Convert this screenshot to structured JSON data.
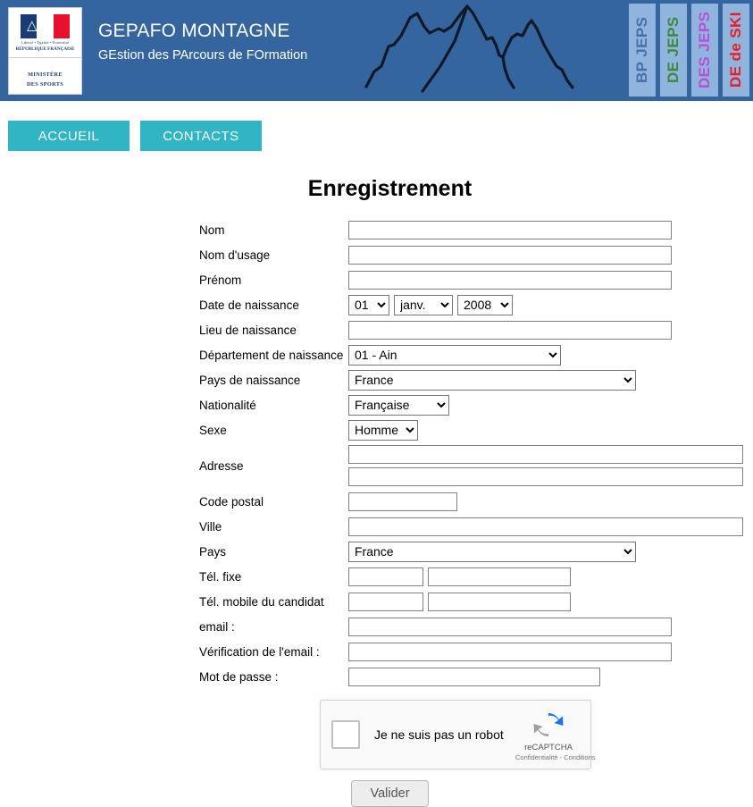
{
  "header": {
    "logo": {
      "devise": "Liberté • Égalité • Fraternité",
      "republic": "RÉPUBLIQUE FRANÇAISE",
      "ministry_line1": "MINISTÈRE",
      "ministry_line2": "DES SPORTS"
    },
    "title": "GEPAFO MONTAGNE",
    "subtitle": "GEstion des PArcours de FOrmation",
    "background_color": "#35659f",
    "badges": [
      {
        "label": "BP JEPS",
        "color": "#4a6fa8"
      },
      {
        "label": "DE JEPS",
        "color": "#3c8a3c"
      },
      {
        "label": "DES JEPS",
        "color": "#b84fd6"
      },
      {
        "label": "DE de SKI",
        "color": "#ee1b24"
      }
    ]
  },
  "nav": {
    "accent_color": "#30b5c4",
    "items": [
      {
        "label": "ACCUEIL"
      },
      {
        "label": "CONTACTS"
      }
    ]
  },
  "main": {
    "title": "Enregistrement",
    "fields": {
      "nom": {
        "label": "Nom",
        "value": ""
      },
      "nom_usage": {
        "label": "Nom d'usage",
        "value": ""
      },
      "prenom": {
        "label": "Prénom",
        "value": ""
      },
      "date_naissance": {
        "label": "Date de naissance",
        "day": "01",
        "month": "janv.",
        "year": "2008"
      },
      "lieu_naissance": {
        "label": "Lieu de naissance",
        "value": ""
      },
      "departement_naissance": {
        "label": "Département de naissance",
        "value": "01 - Ain"
      },
      "pays_naissance": {
        "label": "Pays de naissance",
        "value": "France"
      },
      "nationalite": {
        "label": "Nationalité",
        "value": "Française"
      },
      "sexe": {
        "label": "Sexe",
        "value": "Homme"
      },
      "adresse": {
        "label": "Adresse",
        "line1": "",
        "line2": ""
      },
      "code_postal": {
        "label": "Code postal",
        "value": ""
      },
      "ville": {
        "label": "Ville",
        "value": ""
      },
      "pays": {
        "label": "Pays",
        "value": "France"
      },
      "tel_fixe": {
        "label": "Tél. fixe",
        "indicatif": "",
        "numero": ""
      },
      "tel_mobile": {
        "label": "Tél. mobile du candidat",
        "indicatif": "",
        "numero": ""
      },
      "email": {
        "label": "email :",
        "value": ""
      },
      "email_verif": {
        "label": "Vérification de l'email :",
        "value": ""
      },
      "mot_de_passe": {
        "label": "Mot de passe :",
        "value": ""
      }
    },
    "captcha": {
      "label": "Je ne suis pas un robot",
      "brand": "reCAPTCHA",
      "links": "Confidentialité - Conditions"
    },
    "submit": {
      "label": "Valider"
    }
  }
}
